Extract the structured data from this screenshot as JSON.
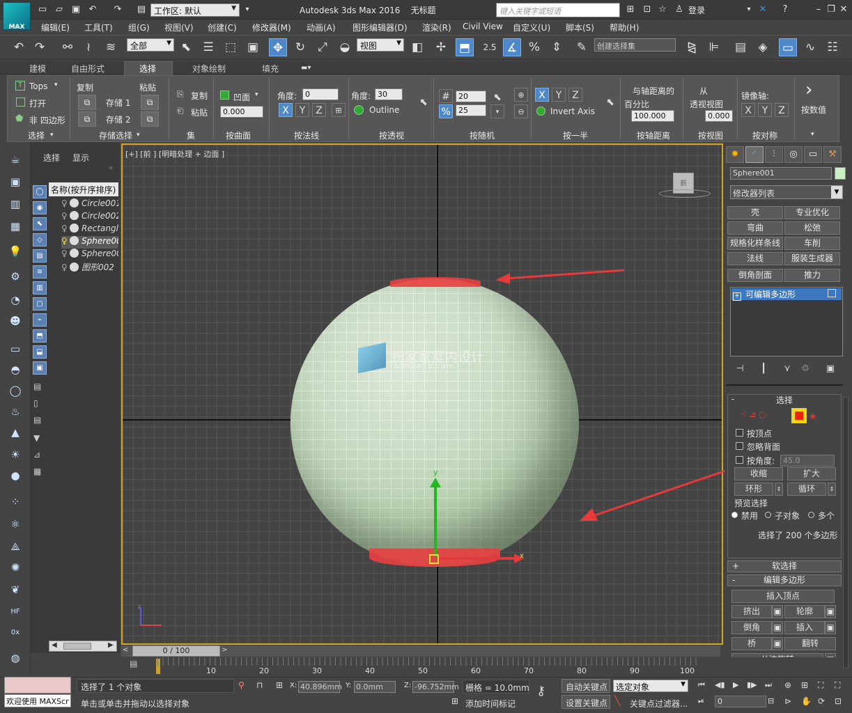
{
  "app": {
    "logo": "MAX",
    "title": "Autodesk 3ds Max 2016",
    "file_name": "无标题",
    "workspace": "工作区: 默认",
    "search_placeholder": "键入关键字或短语",
    "login": "登录"
  },
  "menu": [
    "编辑(E)",
    "工具(T)",
    "组(G)",
    "视图(V)",
    "创建(C)",
    "修改器(M)",
    "动画(A)",
    "图形编辑器(D)",
    "渲染(R)",
    "Civil View",
    "自定义(U)",
    "脚本(S)",
    "帮助(H)"
  ],
  "toolbar": {
    "filter": "全部",
    "ref_coord": "视图",
    "snap_value": "2.5",
    "named_selection_set": "创建选择集"
  },
  "ribbon": {
    "tabs": [
      "建模",
      "自由形式",
      "选择",
      "对象绘制",
      "填充"
    ],
    "active_tab": "选择",
    "tops_label": "Tops",
    "open_label": "打开",
    "non_quad_label": "非 四边形",
    "copy_label": "复制",
    "paste_label": "粘贴",
    "store1_label": "存储 1",
    "store2_label": "存储 2",
    "set_copy": "复制",
    "set_paste": "粘贴",
    "concave_label": "凹面",
    "concave_value": "0.000",
    "angle_label": "角度:",
    "angle_value": "0",
    "angle2_label": "角度:",
    "angle2_value": "30",
    "outline_label": "Outline",
    "random1": "20",
    "random2": "25",
    "invert_axis": "Invert Axis",
    "dist_pct_line1": "与轴距离的",
    "dist_pct_line2": "百分比",
    "dist_pct_value": "100.000",
    "from_persp_line1": "从",
    "from_persp_line2": "透视视图",
    "from_persp_value": "0.000",
    "mirror_axis": "镜像轴:",
    "by_value": "按数值",
    "groups": [
      "选择",
      "存储选择",
      "集",
      "按曲面",
      "按法线",
      "按透视",
      "按随机",
      "按一半",
      "按轴距离",
      "按视图",
      "按对称"
    ]
  },
  "scene_explorer": {
    "tab_select": "选择",
    "tab_display": "显示",
    "header": "名称(按升序排序)",
    "rows": [
      {
        "name": "Circle001",
        "selected": false
      },
      {
        "name": "Circle002",
        "selected": false
      },
      {
        "name": "Rectangle001",
        "selected": false
      },
      {
        "name": "Sphere001",
        "selected": true
      },
      {
        "name": "Sphere002",
        "selected": false
      },
      {
        "name": "图形002",
        "selected": false
      }
    ]
  },
  "viewport": {
    "label": "[+] [前 ] [明暗处理 + 边面 ]",
    "watermark_main": "扮家家室内设计",
    "watermark_sub": "banjiajia.com",
    "gizmo_y": "y",
    "gizmo_x": "x",
    "viewcube_face": "前"
  },
  "command_panel": {
    "object_name": "Sphere001",
    "object_color": "#c8f0c0",
    "modifier_list": "修改器列表",
    "modifier_buttons": [
      "壳",
      "专业优化",
      "弯曲",
      "松弛",
      "规格化样条线",
      "车削",
      "法线",
      "服装生成器",
      "倒角剖面",
      "推力"
    ],
    "stack_item": "可编辑多边形",
    "selection_rollout": {
      "title": "选择",
      "by_vertex": "按顶点",
      "ignore_backfacing": "忽略背面",
      "by_angle": "按角度:",
      "by_angle_value": "45.0",
      "shrink": "收缩",
      "grow": "扩大",
      "ring": "环形",
      "loop": "循环",
      "preview_title": "预览选择",
      "preview_off": "禁用",
      "preview_subobj": "子对象",
      "preview_multi": "多个",
      "selected_count": "选择了 200 个多边形"
    },
    "soft_selection": "软选择",
    "edit_polygons": {
      "title": "编辑多边形",
      "insert_vertex": "插入顶点",
      "extrude": "挤出",
      "outline": "轮廓",
      "bevel": "倒角",
      "inset": "插入",
      "bridge": "桥",
      "flip": "翻转",
      "hinge": "从边旋转"
    }
  },
  "timeline": {
    "slider": "0 / 100",
    "ticks": [
      "10",
      "20",
      "30",
      "40",
      "50",
      "60",
      "70",
      "80",
      "90",
      "100"
    ]
  },
  "status": {
    "maxscript": "欢迎使用 MAXScr",
    "selected": "选择了 1 个对象",
    "prompt": "单击或单击并拖动以选择对象",
    "x": "40.896mm",
    "y": "0.0mm",
    "z": "-96.752mm",
    "grid": "栅格 = 10.0mm",
    "add_time_tag": "添加时间标记",
    "auto_key": "自动关键点",
    "set_key": "设置关键点",
    "key_mode": "选定对象",
    "key_filter": "关键点过滤器...",
    "frame": "0",
    "brand_color": "#1ec0c0",
    "accent_color": "#4e88c8",
    "selection_color": "#e84040"
  }
}
